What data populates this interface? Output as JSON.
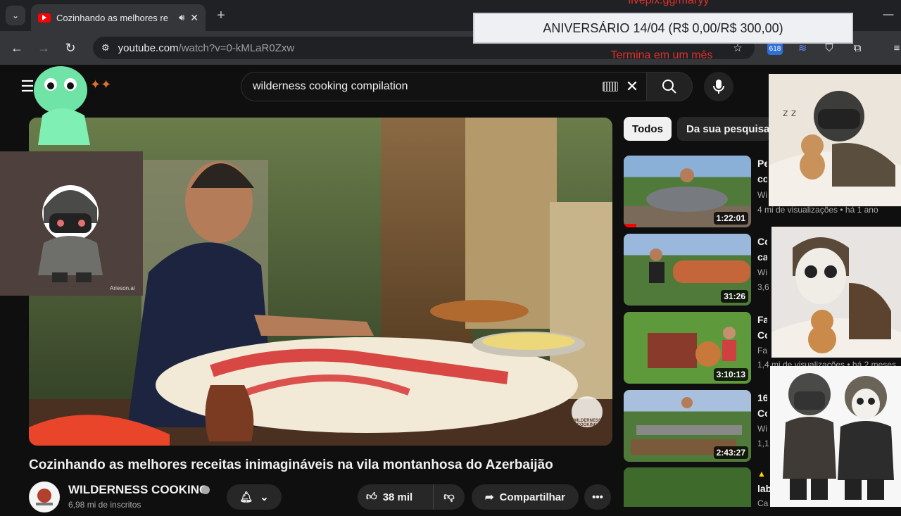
{
  "browser": {
    "tab_title": "Cozinhando as melhores re",
    "url_host": "youtube.com",
    "url_path": "/watch?v=0-kMLaR0Zxw",
    "extension_badge": "618"
  },
  "overlay": {
    "top_text": "livepix.gg/maryy",
    "goal": "ANIVERSÁRIO 14/04 (R$ 0,00/R$ 300,00)",
    "goal_sub": "Termina em um mês",
    "sticker_signature": "Arieson.ai"
  },
  "youtube": {
    "search_query": "wilderness cooking compilation",
    "video_title": "Cozinhando as melhores receitas inimagináveis na vila montanhosa do Azerbaijão",
    "channel_name": "WILDERNESS COOKING",
    "subscribers": "6,98 mi de inscritos",
    "likes": "38 mil",
    "share_label": "Compartilhar",
    "more_label": "•••",
    "watermark": "WILDERNESS COOKING",
    "chips": [
      "Todos",
      "Da sua pesquisa"
    ],
    "related": [
      {
        "duration": "1:22:01",
        "title": "Pe",
        "title2": "co",
        "meta": "Wi",
        "meta2": "4 mi de visualizações • há 1 ano",
        "progress": 0.1
      },
      {
        "duration": "31:26",
        "title": "Co",
        "title2": "ca",
        "meta": "Wi",
        "meta2": "3,6"
      },
      {
        "duration": "3:10:13",
        "title": "Fa",
        "title2": "Co",
        "meta": "Fa",
        "meta2": "1,4 mi de visualizações • há 2 meses"
      },
      {
        "duration": "2:43:27",
        "title": "16",
        "title2": "Co",
        "meta": "Wi",
        "meta2": "1,1"
      },
      {
        "duration": "",
        "title": "lab",
        "title2": "",
        "meta": "Ca",
        "meta2": ""
      }
    ]
  }
}
